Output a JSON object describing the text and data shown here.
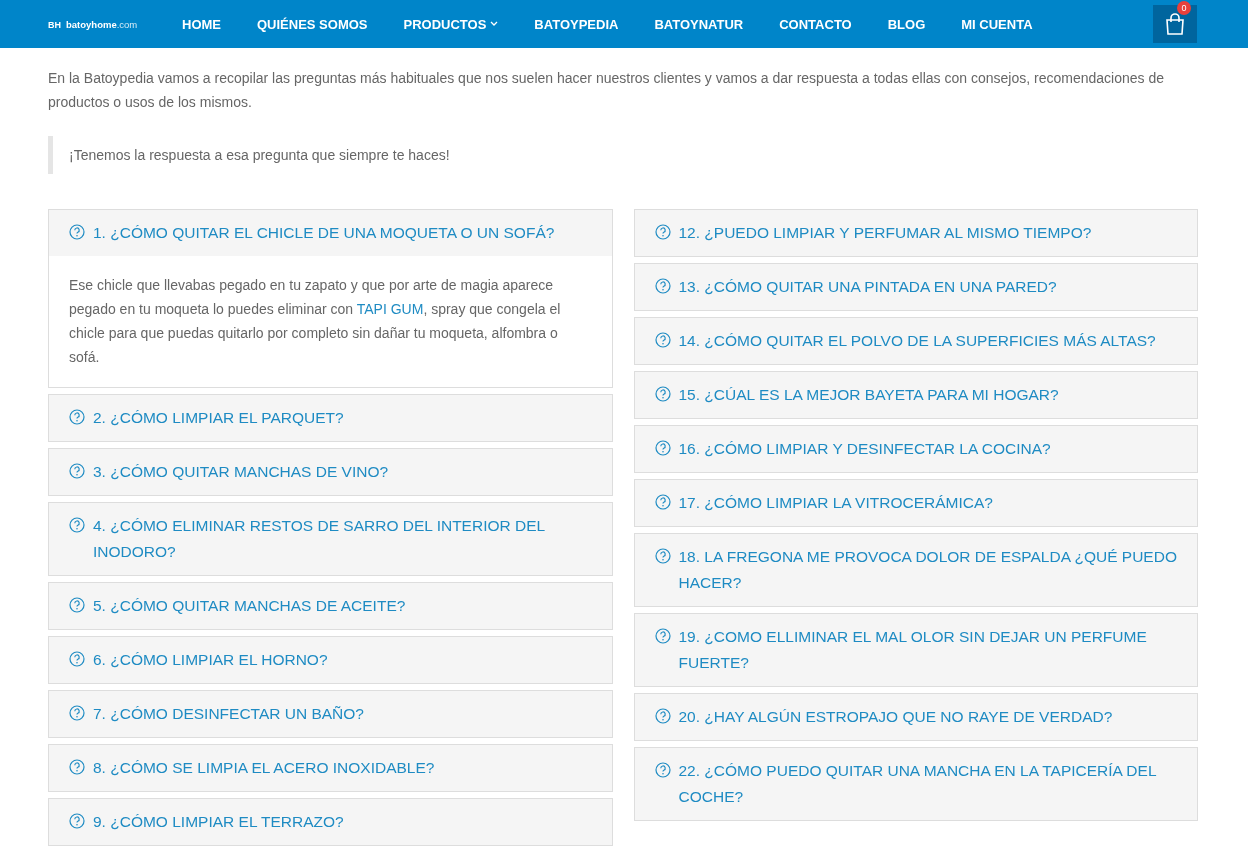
{
  "header": {
    "logo_mark": "BH",
    "logo_name": "batoyhome",
    "logo_suffix": ".com",
    "nav": [
      {
        "label": "HOME",
        "dropdown": false
      },
      {
        "label": "QUIÉNES SOMOS",
        "dropdown": false
      },
      {
        "label": "PRODUCTOS",
        "dropdown": true
      },
      {
        "label": "BATOYPEDIA",
        "dropdown": false
      },
      {
        "label": "BATOYNATUR",
        "dropdown": false
      },
      {
        "label": "CONTACTO",
        "dropdown": false
      },
      {
        "label": "BLOG",
        "dropdown": false
      },
      {
        "label": "MI CUENTA",
        "dropdown": false
      }
    ],
    "cart_count": "0"
  },
  "intro": "En la Batoypedia vamos a recopilar las preguntas más habituales que nos suelen hacer nuestros clientes y vamos a dar respuesta a todas ellas con consejos, recomendaciones de productos o usos de los mismos.",
  "quote": "¡Tenemos la respuesta a esa pregunta que siempre te haces!",
  "faq_columns": [
    [
      {
        "title": "1. ¿CÓMO QUITAR EL CHICLE DE UNA MOQUETA O UN SOFÁ?",
        "expanded": true,
        "answer": {
          "before": "Ese chicle que llevabas pegado en tu zapato y que por arte de magia aparece pegado en tu moqueta lo puedes eliminar con ",
          "link": "TAPI GUM",
          "after": ", spray que congela el chicle para que puedas quitarlo por completo sin dañar tu moqueta, alfombra o sofá."
        }
      },
      {
        "title": "2. ¿CÓMO LIMPIAR EL PARQUET?",
        "expanded": false
      },
      {
        "title": "3. ¿CÓMO QUITAR MANCHAS DE VINO?",
        "expanded": false
      },
      {
        "title": "4. ¿CÓMO ELIMINAR RESTOS DE SARRO DEL INTERIOR DEL INODORO?",
        "expanded": false
      },
      {
        "title": "5. ¿CÓMO QUITAR MANCHAS DE ACEITE?",
        "expanded": false
      },
      {
        "title": "6. ¿CÓMO LIMPIAR EL HORNO?",
        "expanded": false
      },
      {
        "title": "7. ¿CÓMO DESINFECTAR UN BAÑO?",
        "expanded": false
      },
      {
        "title": "8. ¿CÓMO SE LIMPIA EL ACERO INOXIDABLE?",
        "expanded": false
      },
      {
        "title": "9. ¿CÓMO LIMPIAR EL TERRAZO?",
        "expanded": false
      }
    ],
    [
      {
        "title": "12. ¿PUEDO LIMPIAR Y PERFUMAR AL MISMO TIEMPO?",
        "expanded": false
      },
      {
        "title": "13. ¿CÓMO QUITAR UNA PINTADA EN UNA PARED?",
        "expanded": false
      },
      {
        "title": "14. ¿CÓMO QUITAR EL POLVO DE LA SUPERFICIES MÁS ALTAS?",
        "expanded": false
      },
      {
        "title": "15. ¿CÚAL ES LA MEJOR BAYETA PARA MI HOGAR?",
        "expanded": false
      },
      {
        "title": "16. ¿CÓMO LIMPIAR Y DESINFECTAR LA COCINA?",
        "expanded": false
      },
      {
        "title": "17. ¿CÓMO LIMPIAR LA VITROCERÁMICA?",
        "expanded": false
      },
      {
        "title": "18. LA FREGONA ME PROVOCA DOLOR DE ESPALDA ¿QUÉ PUEDO HACER?",
        "expanded": false
      },
      {
        "title": "19. ¿COMO ELLIMINAR EL MAL OLOR SIN DEJAR UN PERFUME FUERTE?",
        "expanded": false
      },
      {
        "title": "20. ¿HAY ALGÚN ESTROPAJO QUE NO RAYE DE VERDAD?",
        "expanded": false
      },
      {
        "title": "22. ¿CÓMO PUEDO QUITAR UNA MANCHA EN LA TAPICERÍA DEL COCHE?",
        "expanded": false
      }
    ]
  ]
}
